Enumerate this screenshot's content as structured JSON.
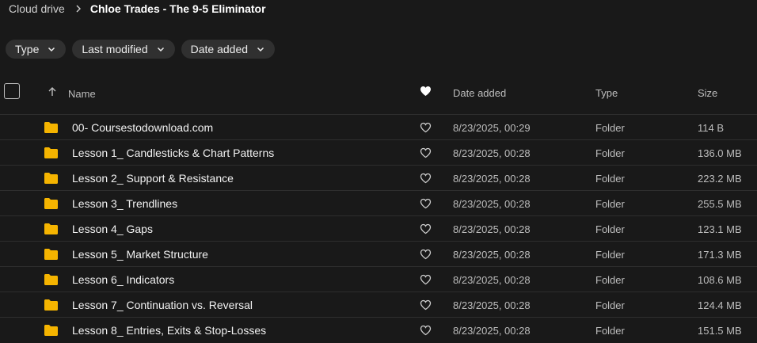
{
  "breadcrumb": {
    "root": "Cloud drive",
    "current": "Chloe Trades - The 9-5 Eliminator"
  },
  "filters": [
    {
      "label": "Type"
    },
    {
      "label": "Last modified"
    },
    {
      "label": "Date added"
    }
  ],
  "columns": {
    "name": "Name",
    "date_added": "Date added",
    "type": "Type",
    "size": "Size"
  },
  "colors": {
    "background": "#191919",
    "folder": "#f5b400",
    "chip": "#303030",
    "divider": "#2e2e2e"
  },
  "icons": {
    "folder": "folder-icon",
    "favorite": "heart-outline-icon",
    "header_favorite": "heart-filled-icon",
    "sort": "arrow-up-icon",
    "chip_dropdown": "chevron-down-icon",
    "breadcrumb_separator": "chevron-right-icon"
  },
  "rows": [
    {
      "name": "00- Coursestodownload.com",
      "date": "8/23/2025, 00:29",
      "type": "Folder",
      "size": "114 B"
    },
    {
      "name": "Lesson 1_ Candlesticks & Chart Patterns",
      "date": "8/23/2025, 00:28",
      "type": "Folder",
      "size": "136.0 MB"
    },
    {
      "name": "Lesson 2_ Support & Resistance",
      "date": "8/23/2025, 00:28",
      "type": "Folder",
      "size": "223.2 MB"
    },
    {
      "name": "Lesson 3_ Trendlines",
      "date": "8/23/2025, 00:28",
      "type": "Folder",
      "size": "255.5 MB"
    },
    {
      "name": "Lesson 4_ Gaps",
      "date": "8/23/2025, 00:28",
      "type": "Folder",
      "size": "123.1 MB"
    },
    {
      "name": "Lesson 5_ Market Structure",
      "date": "8/23/2025, 00:28",
      "type": "Folder",
      "size": "171.3 MB"
    },
    {
      "name": "Lesson 6_ Indicators",
      "date": "8/23/2025, 00:28",
      "type": "Folder",
      "size": "108.6 MB"
    },
    {
      "name": "Lesson 7_ Continuation vs. Reversal",
      "date": "8/23/2025, 00:28",
      "type": "Folder",
      "size": "124.4 MB"
    },
    {
      "name": "Lesson 8_ Entries, Exits & Stop-Losses",
      "date": "8/23/2025, 00:28",
      "type": "Folder",
      "size": "151.5 MB"
    }
  ]
}
